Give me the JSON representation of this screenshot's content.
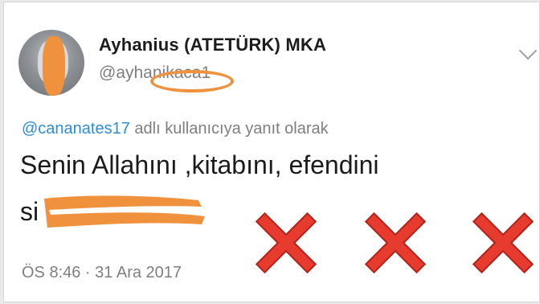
{
  "tweet": {
    "display_name": "Ayhanius (ATETÜRK) MKA",
    "handle": "@ayhanikaca1",
    "reply_mention": "@cananates17",
    "reply_context": " adlı kullanıcıya yanıt olarak",
    "text_line1": "Senin Allahını ,kitabını, efendini",
    "text_line2": "si",
    "timestamp": "ÖS 8:46 · 31 Ara 2017"
  },
  "overlay": {
    "marks": [
      "x-mark",
      "x-mark",
      "x-mark"
    ],
    "censor_color": "#f0913d",
    "x_color": "#e63b2e"
  },
  "icons": {
    "menu": "chevron-down-icon"
  }
}
